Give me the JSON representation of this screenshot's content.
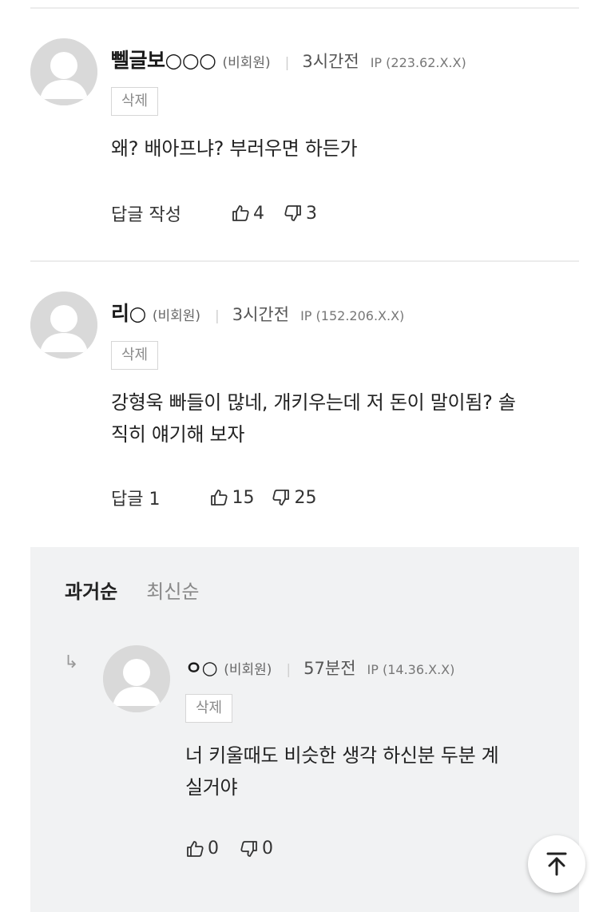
{
  "comments": [
    {
      "nickname": "뻴글보○○○",
      "guest": "(비회원)",
      "time": "3시간전",
      "ip": "IP (223.62.X.X)",
      "delete_label": "삭제",
      "lines": [
        "왜? 배아프냐? 부러우면 하든가"
      ],
      "reply_label": "답글 작성",
      "likes": "4",
      "dislikes": "3"
    },
    {
      "nickname": "리○",
      "guest": "(비회원)",
      "time": "3시간전",
      "ip": "IP (152.206.X.X)",
      "delete_label": "삭제",
      "lines": [
        "강형욱 빠들이 많네, 개키우는데 저 돈이 말이됨? 솔",
        "직히 얘기해 보자"
      ],
      "reply_label": "답글 1",
      "likes": "15",
      "dislikes": "25"
    }
  ],
  "reply_sort": {
    "active": "과거순",
    "inactive": "최신순"
  },
  "reply": {
    "arrow": "↳",
    "nickname": "ㅇ○",
    "guest": "(비회원)",
    "time": "57분전",
    "ip": "IP (14.36.X.X)",
    "delete_label": "삭제",
    "lines": [
      "너 키울때도 비슷한 생각 하신분 두분 계",
      "실거야"
    ],
    "likes": "0",
    "dislikes": "0"
  },
  "icons": {
    "avatar": "default-avatar-icon",
    "like": "thumbs-up-icon",
    "dislike": "thumbs-down-icon",
    "scroll_top": "arrow-up-to-top-icon"
  }
}
